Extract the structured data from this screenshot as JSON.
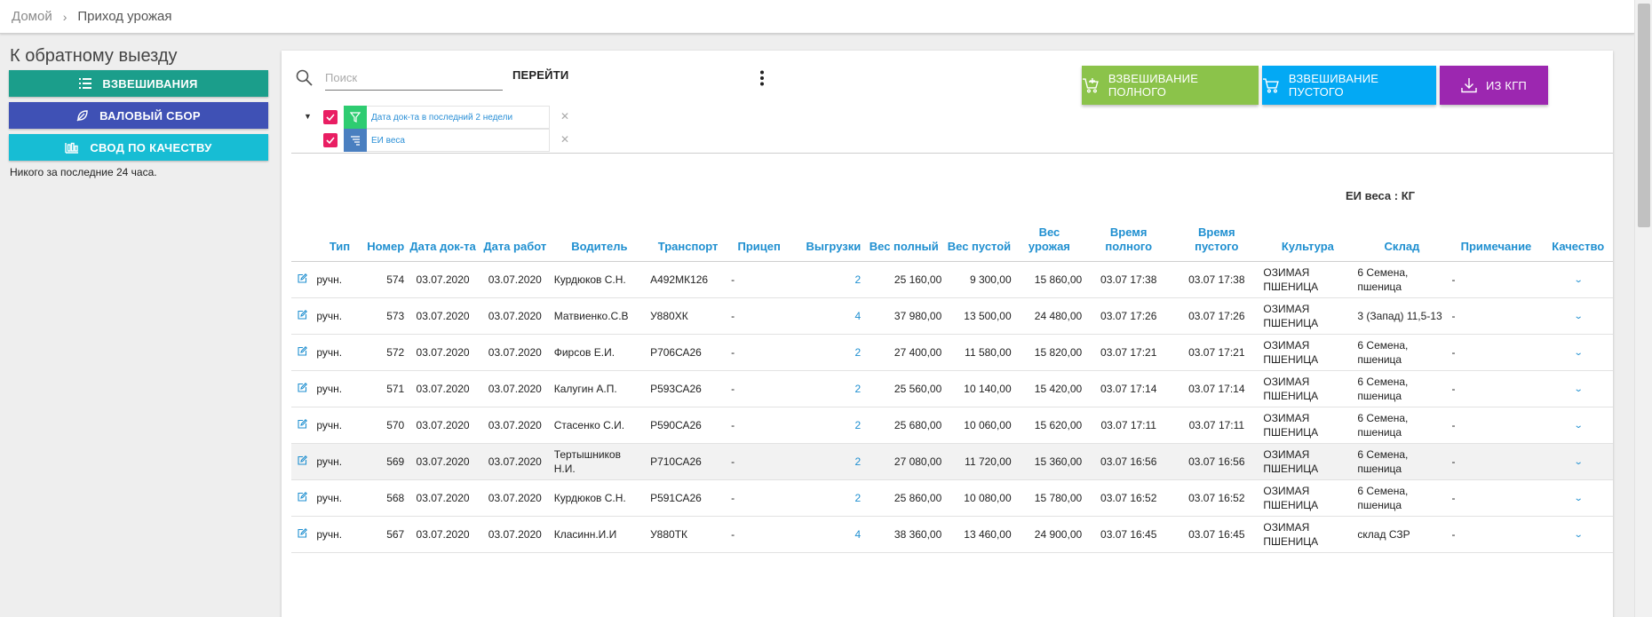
{
  "breadcrumb": {
    "home": "Домой",
    "separator": "›",
    "current": "Приход урожая"
  },
  "sidebar": {
    "title": "К обратному выезду",
    "buttons": [
      {
        "label": "ВЗВЕШИВАНИЯ",
        "icon": "list-icon",
        "color": "#1b9e8b"
      },
      {
        "label": "ВАЛОВЫЙ СБОР",
        "icon": "leaf-icon",
        "color": "#3f51b5"
      },
      {
        "label": "СВОД ПО КАЧЕСТВУ",
        "icon": "equalizer-icon",
        "color": "#17bdd4"
      }
    ],
    "note": "Никого за последние 24 часа."
  },
  "toolbar": {
    "search_placeholder": "Поиск",
    "go_label": "ПЕРЕЙТИ",
    "actions": [
      {
        "label": "ВЗВЕШИВАНИЕ ПОЛНОГО",
        "icon": "cart-plus-icon",
        "color": "#8bc34a"
      },
      {
        "label": "ВЗВЕШИВАНИЕ ПУСТОГО",
        "icon": "cart-icon",
        "color": "#03a9f4"
      },
      {
        "label": "ИЗ КГП",
        "icon": "download-icon",
        "color": "#9c27b0"
      }
    ]
  },
  "filters": [
    {
      "text": "Дата док-та в последний 2 недели",
      "icon": "filter-icon",
      "checked": true
    },
    {
      "text": "ЕИ веса",
      "icon": "sort-icon",
      "checked": true
    }
  ],
  "unit_label": "ЕИ веса : КГ",
  "table": {
    "headers": {
      "type": "Тип",
      "number": "Номер",
      "doc_date": "Дата док-та",
      "work_date": "Дата работ",
      "driver": "Водитель",
      "transport": "Транспорт",
      "trailer": "Прицеп",
      "unloads": "Выгрузки",
      "weight_full": "Вес полный",
      "weight_empty": "Вес пустой",
      "weight_harvest": "Вес урожая",
      "time_full": "Время полного",
      "time_empty": "Время пустого",
      "culture": "Культура",
      "storage": "Склад",
      "note": "Примечание",
      "quality": "Качество"
    },
    "rows": [
      {
        "type": "ручн.",
        "number": "574",
        "doc_date": "03.07.2020",
        "work_date": "03.07.2020",
        "driver": "Курдюков С.Н.",
        "transport": "А492МК126",
        "trailer": "-",
        "unloads": "2",
        "weight_full": "25 160,00",
        "weight_empty": "9 300,00",
        "weight_harvest": "15 860,00",
        "time_full": "03.07 17:38",
        "time_empty": "03.07 17:38",
        "culture": "ОЗИМАЯ ПШЕНИЦА",
        "storage": "6 Семена, пшеница",
        "note": "-"
      },
      {
        "type": "ручн.",
        "number": "573",
        "doc_date": "03.07.2020",
        "work_date": "03.07.2020",
        "driver": "Матвиенко.С.В",
        "transport": "У880ХК",
        "trailer": "-",
        "unloads": "4",
        "weight_full": "37 980,00",
        "weight_empty": "13 500,00",
        "weight_harvest": "24 480,00",
        "time_full": "03.07 17:26",
        "time_empty": "03.07 17:26",
        "culture": "ОЗИМАЯ ПШЕНИЦА",
        "storage": "3 (Запад) 11,5-13",
        "note": "-"
      },
      {
        "type": "ручн.",
        "number": "572",
        "doc_date": "03.07.2020",
        "work_date": "03.07.2020",
        "driver": "Фирсов Е.И.",
        "transport": "Р706СА26",
        "trailer": "-",
        "unloads": "2",
        "weight_full": "27 400,00",
        "weight_empty": "11 580,00",
        "weight_harvest": "15 820,00",
        "time_full": "03.07 17:21",
        "time_empty": "03.07 17:21",
        "culture": "ОЗИМАЯ ПШЕНИЦА",
        "storage": "6 Семена, пшеница",
        "note": "-"
      },
      {
        "type": "ручн.",
        "number": "571",
        "doc_date": "03.07.2020",
        "work_date": "03.07.2020",
        "driver": "Калугин А.П.",
        "transport": "Р593СА26",
        "trailer": "-",
        "unloads": "2",
        "weight_full": "25 560,00",
        "weight_empty": "10 140,00",
        "weight_harvest": "15 420,00",
        "time_full": "03.07 17:14",
        "time_empty": "03.07 17:14",
        "culture": "ОЗИМАЯ ПШЕНИЦА",
        "storage": "6 Семена, пшеница",
        "note": "-"
      },
      {
        "type": "ручн.",
        "number": "570",
        "doc_date": "03.07.2020",
        "work_date": "03.07.2020",
        "driver": "Стасенко С.И.",
        "transport": "Р590СА26",
        "trailer": "-",
        "unloads": "2",
        "weight_full": "25 680,00",
        "weight_empty": "10 060,00",
        "weight_harvest": "15 620,00",
        "time_full": "03.07 17:11",
        "time_empty": "03.07 17:11",
        "culture": "ОЗИМАЯ ПШЕНИЦА",
        "storage": "6 Семена, пшеница",
        "note": "-"
      },
      {
        "type": "ручн.",
        "number": "569",
        "doc_date": "03.07.2020",
        "work_date": "03.07.2020",
        "driver": "Тертышников Н.И.",
        "transport": "Р710СА26",
        "trailer": "-",
        "unloads": "2",
        "weight_full": "27 080,00",
        "weight_empty": "11 720,00",
        "weight_harvest": "15 360,00",
        "time_full": "03.07 16:56",
        "time_empty": "03.07 16:56",
        "culture": "ОЗИМАЯ ПШЕНИЦА",
        "storage": "6 Семена, пшеница",
        "note": "-"
      },
      {
        "type": "ручн.",
        "number": "568",
        "doc_date": "03.07.2020",
        "work_date": "03.07.2020",
        "driver": "Курдюков С.Н.",
        "transport": "Р591СА26",
        "trailer": "-",
        "unloads": "2",
        "weight_full": "25 860,00",
        "weight_empty": "10 080,00",
        "weight_harvest": "15 780,00",
        "time_full": "03.07 16:52",
        "time_empty": "03.07 16:52",
        "culture": "ОЗИМАЯ ПШЕНИЦА",
        "storage": "6 Семена, пшеница",
        "note": "-"
      },
      {
        "type": "ручн.",
        "number": "567",
        "doc_date": "03.07.2020",
        "work_date": "03.07.2020",
        "driver": "Класинн.И.И",
        "transport": "У880ТК",
        "trailer": "-",
        "unloads": "4",
        "weight_full": "38 360,00",
        "weight_empty": "13 460,00",
        "weight_harvest": "24 900,00",
        "time_full": "03.07 16:45",
        "time_empty": "03.07 16:45",
        "culture": "ОЗИМАЯ ПШЕНИЦА",
        "storage": "склад СЗР",
        "note": "-"
      }
    ],
    "highlighted_row_number": "569"
  },
  "colors": {
    "accent_link": "#1f8fd0",
    "checkbox": "#e91e63"
  }
}
